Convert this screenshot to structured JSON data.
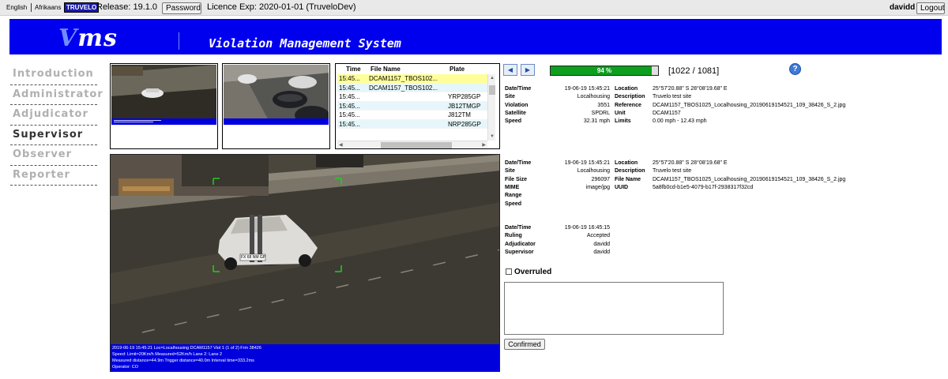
{
  "topbar": {
    "lang_english": "English",
    "lang_afrikaans": "Afrikaans",
    "brand": "TRUVELO",
    "release": "Release: 19.1.0",
    "password_btn": "Password",
    "licence": "Licence Exp: 2020-01-01 (TruveloDev)",
    "username": "davidd",
    "logout_btn": "Logout"
  },
  "banner": {
    "logo_v": "V",
    "logo_rest": "ms",
    "title": "Violation Management System"
  },
  "sidebar": {
    "items": [
      {
        "label": "Introduction"
      },
      {
        "label": "Administrator"
      },
      {
        "label": "Adjudicator"
      },
      {
        "label": "Supervisor"
      },
      {
        "label": "Observer"
      },
      {
        "label": "Reporter"
      }
    ]
  },
  "list": {
    "headers": {
      "time": "Time",
      "file": "File Name",
      "plate": "Plate"
    },
    "rows": [
      {
        "time": "15:45...",
        "file": "DCAM1157_TBOS102...",
        "plate": ""
      },
      {
        "time": "15:45...",
        "file": "DCAM1157_TBOS102...",
        "plate": ""
      },
      {
        "time": "15:45...",
        "file": "",
        "plate": "YRP285GP"
      },
      {
        "time": "15:45...",
        "file": "",
        "plate": "JB12TMGP"
      },
      {
        "time": "15:45...",
        "file": "",
        "plate": "J812TM"
      },
      {
        "time": "15:45...",
        "file": "",
        "plate": "NRP285GP"
      }
    ]
  },
  "progress": {
    "percent_label": "94 %",
    "fraction": 0.94,
    "counter": "[1022 / 1081]"
  },
  "help_icon": "?",
  "info1": {
    "left": [
      {
        "label": "Date/Time",
        "value": "19-06-19 15:45:21"
      },
      {
        "label": "Site",
        "value": "Localhousing"
      },
      {
        "label": "Violation",
        "value": "3551"
      },
      {
        "label": "Satellite",
        "value": "SPDRL"
      },
      {
        "label": "Speed",
        "value": "32.31 mph"
      }
    ],
    "right": [
      {
        "label": "Location",
        "value": "25°57'20.88\" S 28°08'19.68\" E"
      },
      {
        "label": "Description",
        "value": "Truvelo test site"
      },
      {
        "label": "Reference",
        "value": "DCAM1157_TBOS1025_Localhousing_20190619154521_109_38426_S_2.jpg"
      },
      {
        "label": "Unit",
        "value": "DCAM1157"
      },
      {
        "label": "Limits",
        "value": "0.00 mph - 12.43 mph"
      }
    ]
  },
  "info2": {
    "left": [
      {
        "label": "Date/Time",
        "value": "19-06-19 15:45:21"
      },
      {
        "label": "Site",
        "value": "Localhousing"
      },
      {
        "label": "File Size",
        "value": "296097"
      },
      {
        "label": "MIME",
        "value": "image/jpg"
      },
      {
        "label": "Range",
        "value": ""
      },
      {
        "label": "Speed",
        "value": ""
      }
    ],
    "right": [
      {
        "label": "Location",
        "value": "25°57'20.88\" S 28°08'19.68\" E"
      },
      {
        "label": "Description",
        "value": "Truvelo test site"
      },
      {
        "label": "File Name",
        "value": "DCAM1157_TBOS1025_Localhousing_20190619154521_109_38426_S_2.jpg"
      },
      {
        "label": "UUID",
        "value": "5a8fb0cd-b1e5-4079-b17f-2938317f32cd"
      }
    ]
  },
  "info3": {
    "rows": [
      {
        "label": "Date/Time",
        "value": "19-06-19 16:45:15"
      },
      {
        "label": "Ruling",
        "value": "Accepted"
      },
      {
        "label": "Adjudicator",
        "value": "davidd"
      },
      {
        "label": "Supervisor",
        "value": "davidd"
      }
    ]
  },
  "overruled_label": "Overruled",
  "notes_value": "",
  "confirm_btn": "Confirmed",
  "image_overlay": {
    "line1": "2019-06-19 15:45:21 Loc=Localhousing DCAM1157 Viol 1 (1 of 2) Frm 38426",
    "line2": "Speed: Limit=20Km/h Measured=52Km/h Lane 2: Lane 2",
    "line3": "Measured distance=44.9m Trigger distance=40.0m  Interval time=333.2ms",
    "line4": "Operator: CO"
  },
  "plate_text": "FX 68 NM GP"
}
